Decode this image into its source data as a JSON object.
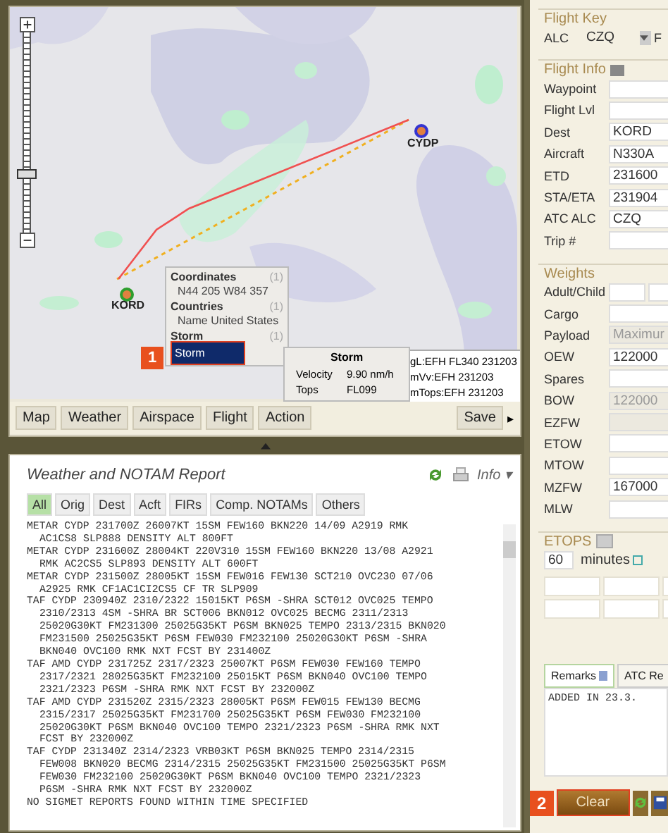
{
  "map": {
    "zoom": {
      "level": 0.27
    },
    "airports": [
      {
        "code": "KORD",
        "color": "#2e9e2e"
      },
      {
        "code": "CYDP",
        "color": "#3434d0"
      }
    ],
    "popup": {
      "callout": "1",
      "sections": [
        {
          "title": "Coordinates",
          "count": "(1)",
          "value": "N44 205 W84 357",
          "selected": false
        },
        {
          "title": "Countries",
          "count": "(1)",
          "value": "Name United States",
          "selected": false
        },
        {
          "title": "Storm",
          "count": "(1)",
          "value": "Storm",
          "selected": true
        }
      ]
    },
    "tooltip": {
      "title": "Storm",
      "rows": [
        {
          "label": "Velocity",
          "value": "9.90 nm/h"
        },
        {
          "label": "Tops",
          "value": "FL099"
        }
      ]
    },
    "legend": [
      "gL:EFH FL340 231203",
      "mVv:EFH 231203",
      "mTops:EFH 231203"
    ],
    "toolbar": {
      "buttons": [
        "Map",
        "Weather",
        "Airspace",
        "Flight",
        "Action"
      ],
      "save": "Save",
      "more": "▸"
    }
  },
  "report": {
    "title": "Weather and NOTAM Report",
    "menu": "Info",
    "menu_caret": "▾",
    "tabs": [
      {
        "label": "All",
        "selected": true
      },
      {
        "label": "Orig",
        "selected": false
      },
      {
        "label": "Dest",
        "selected": false
      },
      {
        "label": "Acft",
        "selected": false
      },
      {
        "label": "FIRs",
        "selected": false
      },
      {
        "label": "Comp. NOTAMs",
        "selected": false
      },
      {
        "label": "Others",
        "selected": false
      }
    ],
    "entries": [
      [
        "METAR CYDP 231700Z 26007KT 15SM FEW160 BKN220 14/09 A2919 RMK",
        "AC1CS8 SLP888 DENSITY ALT 800FT"
      ],
      [
        "METAR CYDP 231600Z 28004KT 220V310 15SM FEW160 BKN220 13/08 A2921",
        "RMK AC2CS5 SLP893 DENSITY ALT 600FT"
      ],
      [
        "METAR CYDP 231500Z 28005KT 15SM FEW016 FEW130 SCT210 OVC230 07/06",
        "A2925 RMK CF1AC1CI2CS5 CF TR SLP909"
      ],
      [
        "TAF CYDP 230940Z 2310/2322 15015KT P6SM -SHRA SCT012 OVC025 TEMPO",
        "2310/2313 4SM -SHRA BR SCT006 BKN012 OVC025 BECMG 2311/2313",
        "25020G30KT FM231300 25025G35KT P6SM BKN025 TEMPO 2313/2315 BKN020",
        "FM231500 25025G35KT P6SM FEW030 FM232100 25020G30KT P6SM -SHRA",
        "BKN040 OVC100 RMK NXT FCST BY 231400Z"
      ],
      [
        "TAF AMD CYDP 231725Z 2317/2323 25007KT P6SM FEW030 FEW160 TEMPO",
        "2317/2321 28025G35KT FM232100 25015KT P6SM BKN040 OVC100 TEMPO",
        "2321/2323 P6SM -SHRA RMK NXT FCST BY 232000Z"
      ],
      [
        "TAF AMD CYDP 231520Z 2315/2323 28005KT P6SM FEW015 FEW130 BECMG",
        "2315/2317 25025G35KT FM231700 25025G35KT P6SM FEW030 FM232100",
        "25020G30KT P6SM BKN040 OVC100 TEMPO 2321/2323 P6SM -SHRA RMK NXT",
        "FCST BY 232000Z"
      ],
      [
        "TAF CYDP 231340Z 2314/2323 VRB03KT P6SM BKN025 TEMPO 2314/2315",
        "FEW008 BKN020 BECMG 2314/2315 25025G35KT FM231500 25025G35KT P6SM",
        "FEW030 FM232100 25020G30KT P6SM BKN040 OVC100 TEMPO 2321/2323",
        "P6SM -SHRA RMK NXT FCST BY 232000Z"
      ],
      [
        "NO SIGMET REPORTS FOUND WITHIN TIME SPECIFIED"
      ]
    ]
  },
  "flight_key": {
    "title": "Flight Key",
    "label": "ALC",
    "value": "CZQ",
    "cut_label": "F"
  },
  "flight_info": {
    "title": "Flight Info",
    "fields": [
      {
        "label": "Waypoint"
      },
      {
        "label": "Flight Lvl"
      },
      {
        "label": "Dest",
        "value": "KORD"
      },
      {
        "label": "Aircraft",
        "value": "N330A"
      },
      {
        "label": "ETD",
        "value": "231600"
      },
      {
        "label": "STA/ETA",
        "value": "231904"
      },
      {
        "label": "ATC ALC",
        "value": "CZQ"
      },
      {
        "label": "Trip #"
      }
    ]
  },
  "weights": {
    "title": "Weights",
    "fields": [
      {
        "label": "Adult/Child",
        "kind": "pair",
        "disabled": false
      },
      {
        "label": "Cargo",
        "kind": "input",
        "disabled": false
      },
      {
        "label": "Payload",
        "kind": "select",
        "value": "Maximur",
        "disabled": true
      },
      {
        "label": "OEW",
        "kind": "input",
        "value": "122000",
        "disabled": false
      },
      {
        "label": "Spares",
        "kind": "input",
        "disabled": false
      },
      {
        "label": "BOW",
        "kind": "input",
        "value": "122000",
        "disabled": true
      },
      {
        "label": "EZFW",
        "kind": "input",
        "disabled": true
      },
      {
        "label": "ETOW",
        "kind": "input",
        "disabled": false
      },
      {
        "label": "MTOW",
        "kind": "input",
        "disabled": false
      },
      {
        "label": "MZFW",
        "kind": "input",
        "value": "167000",
        "disabled": false
      },
      {
        "label": "MLW",
        "kind": "input",
        "disabled": false
      }
    ]
  },
  "etops": {
    "title": "ETOPS",
    "value": "60",
    "unit": "minutes"
  },
  "remarks": {
    "tabs": [
      {
        "label": "Remarks",
        "selected": true
      },
      {
        "label": "ATC Re",
        "selected": false
      }
    ],
    "text": "ADDED IN 23.3."
  },
  "actions": {
    "callout": "2",
    "clear": "Clear"
  }
}
